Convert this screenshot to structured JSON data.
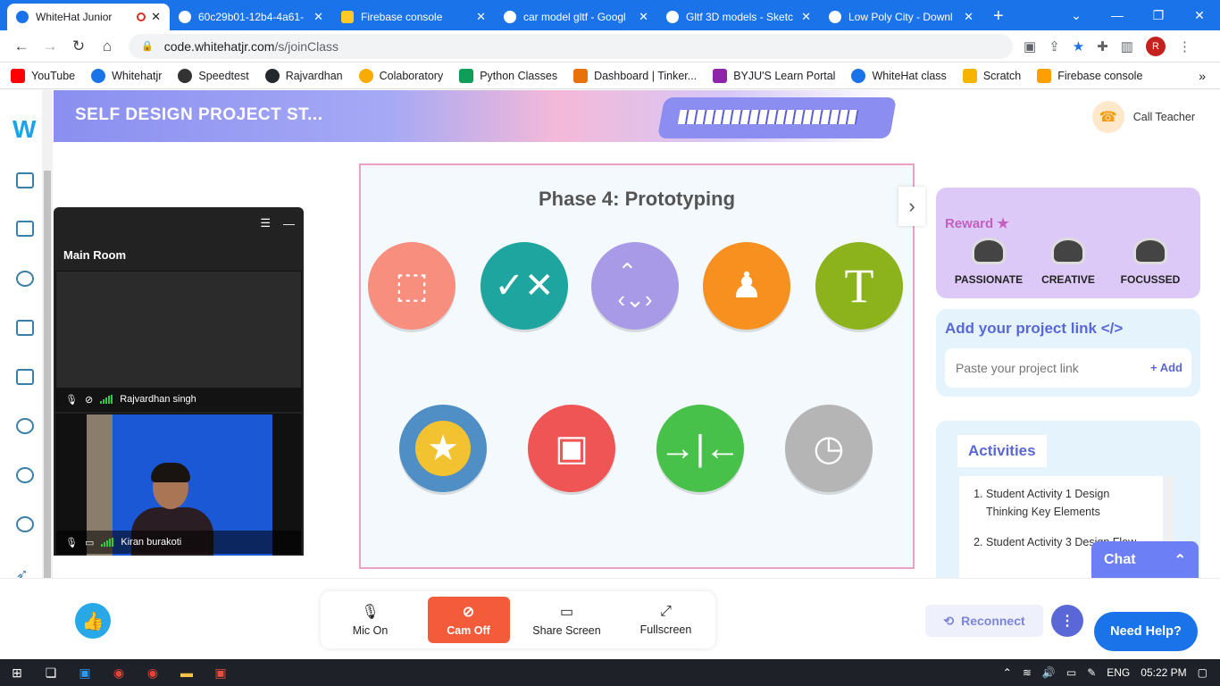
{
  "browser": {
    "tabs": [
      {
        "title": "WhiteHat Junior",
        "active": true,
        "recording": true
      },
      {
        "title": "60c29b01-12b4-4a61-",
        "active": false
      },
      {
        "title": "Firebase console",
        "active": false
      },
      {
        "title": "car model gltf - Googl",
        "active": false
      },
      {
        "title": "Gltf 3D models - Sketc",
        "active": false
      },
      {
        "title": "Low Poly City - Downl",
        "active": false
      }
    ],
    "url_host": "code.whitehatjr.com",
    "url_path": "/s/joinClass",
    "profile_initial": "R",
    "bookmarks": [
      {
        "label": "YouTube",
        "color": "#ff0000"
      },
      {
        "label": "Whitehatjr",
        "color": "#1a73e8"
      },
      {
        "label": "Speedtest",
        "color": "#333333"
      },
      {
        "label": "Rajvardhan",
        "color": "#24292e"
      },
      {
        "label": "Colaboratory",
        "color": "#f9ab00"
      },
      {
        "label": "Python Classes",
        "color": "#0f9d58"
      },
      {
        "label": "Dashboard | Tinker...",
        "color": "#e8710a"
      },
      {
        "label": "BYJU'S Learn Portal",
        "color": "#8e24aa"
      },
      {
        "label": "WhiteHat class",
        "color": "#1a73e8"
      },
      {
        "label": "Scratch",
        "color": "#f4b400"
      },
      {
        "label": "Firebase console",
        "color": "#ffa000"
      }
    ]
  },
  "header": {
    "banner_title": "SELF DESIGN PROJECT ST...",
    "call_teacher": "Call Teacher"
  },
  "video": {
    "room_title": "Main Room",
    "participants": [
      {
        "name": "Rajvardhan singh"
      },
      {
        "name": "Kiran burakoti"
      }
    ]
  },
  "slide": {
    "title": "Phase 4: Prototyping",
    "icons": [
      {
        "name": "wireframe-box-icon",
        "color": "#f88e7e"
      },
      {
        "name": "check-cross-board-icon",
        "color": "#1fa5a0"
      },
      {
        "name": "arrow-keys-icon",
        "color": "#a99ae8"
      },
      {
        "name": "person-network-icon",
        "color": "#f7901e"
      },
      {
        "name": "text-frame-icon",
        "color": "#8cb31c"
      },
      {
        "name": "star-medal-icon",
        "color": "#4f8fc6"
      },
      {
        "name": "monitor-user-icon",
        "color": "#ef5555"
      },
      {
        "name": "converge-arrows-icon",
        "color": "#47c14a"
      },
      {
        "name": "stopwatch-icon",
        "color": "#b5b5b5"
      }
    ]
  },
  "reward": {
    "title": "Reward",
    "badges": [
      "PASSIONATE",
      "CREATIVE",
      "FOCUSSED"
    ]
  },
  "project": {
    "title": "Add your project link </>",
    "placeholder": "Paste your project link",
    "add_label": "+ Add"
  },
  "activities": {
    "tab_label": "Activities",
    "items": [
      "Student Activity 1 Design Thinking Key Elements",
      "Student Activity 3 Design Flow"
    ]
  },
  "chat": {
    "label": "Chat"
  },
  "controls": {
    "mic": "Mic On",
    "cam": "Cam Off",
    "share": "Share Screen",
    "fullscreen": "Fullscreen",
    "reconnect": "Reconnect",
    "help": "Need Help?"
  },
  "taskbar": {
    "language": "ENG",
    "time": "05:22 PM"
  }
}
